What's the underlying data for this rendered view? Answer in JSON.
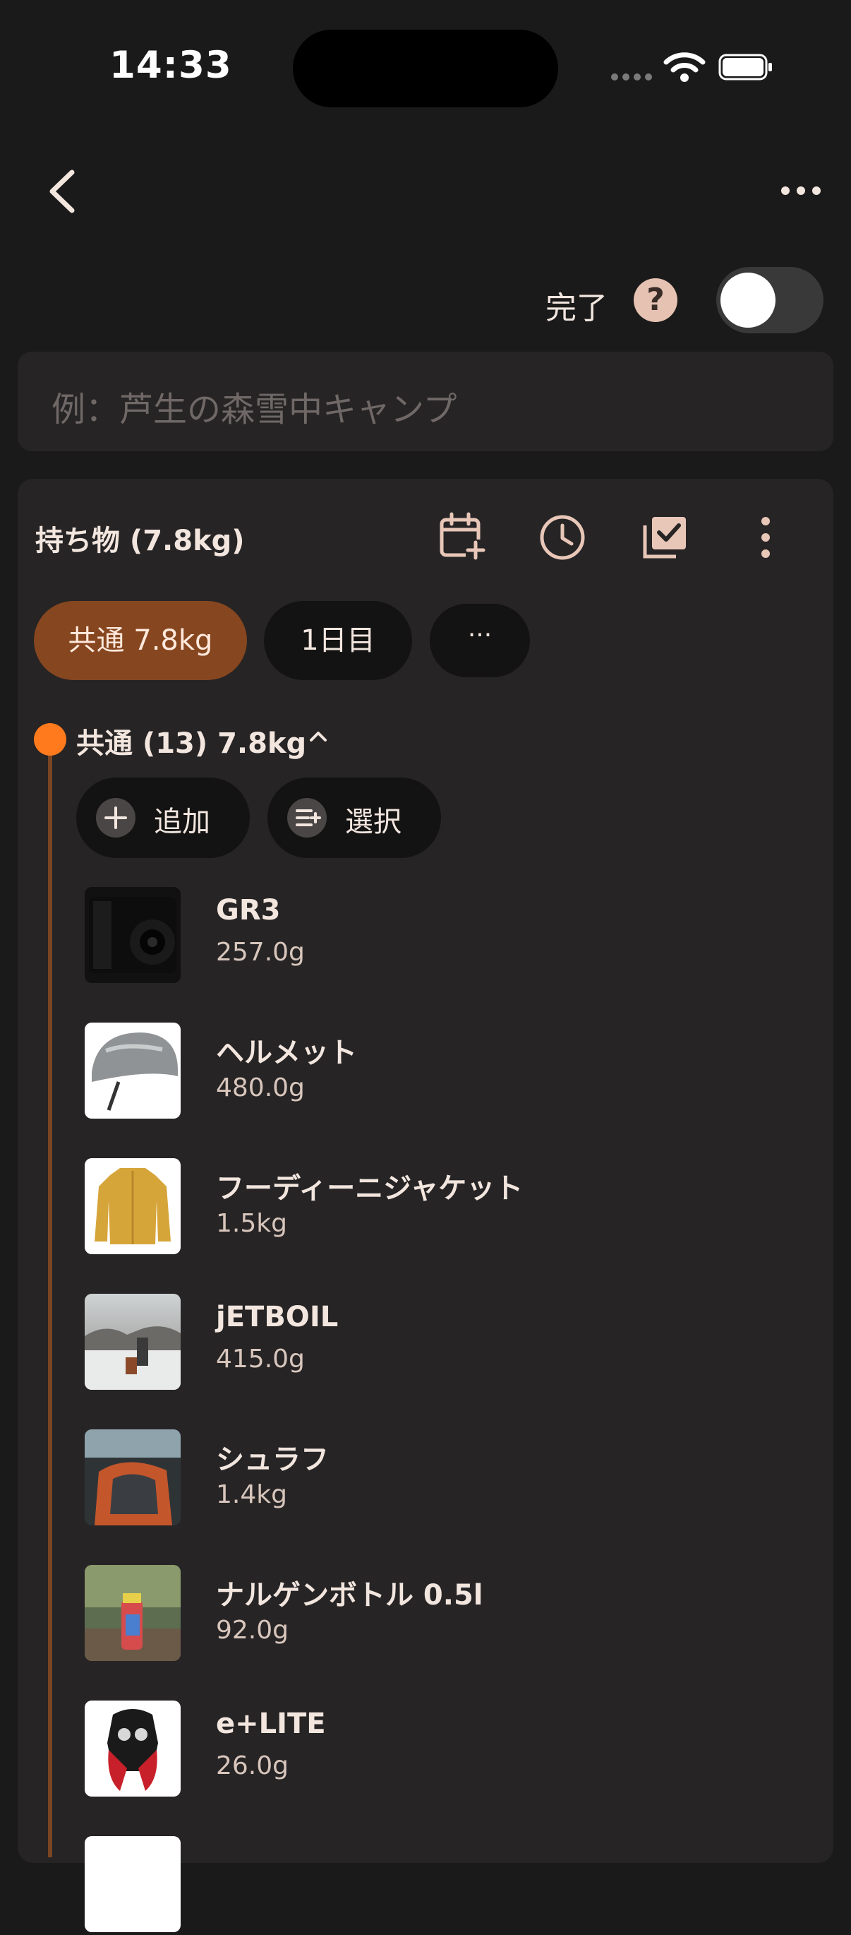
{
  "status": {
    "time": "14:33"
  },
  "header": {
    "done_label": "完了",
    "help_label": "?"
  },
  "title_input": {
    "placeholder": "例：芦生の森雪中キャンプ"
  },
  "packing": {
    "title": "持ち物 (7.8kg)",
    "tabs": [
      {
        "label": "共通 7.8kg",
        "active": true
      },
      {
        "label": "1日目",
        "active": false
      },
      {
        "label": "···",
        "active": false
      }
    ],
    "group": {
      "label": "共通 (13) 7.8kg",
      "accent": "#ff7a1c"
    },
    "actions": {
      "add_label": "追加",
      "select_label": "選択"
    },
    "items": [
      {
        "name": "GR3",
        "weight": "257.0g"
      },
      {
        "name": "ヘルメット",
        "weight": "480.0g"
      },
      {
        "name": "フーディーニジャケット",
        "weight": "1.5kg"
      },
      {
        "name": "jETBOIL",
        "weight": "415.0g"
      },
      {
        "name": "シュラフ",
        "weight": "1.4kg"
      },
      {
        "name": "ナルゲンボトル 0.5l",
        "weight": "92.0g"
      },
      {
        "name": "e+LITE",
        "weight": "26.0g"
      }
    ]
  },
  "colors": {
    "background": "#1b1a1a",
    "card": "#262425",
    "active_tab": "#86461f",
    "accent": "#ff7a1c"
  },
  "icons": [
    "back-icon",
    "more-horizontal-icon",
    "help-icon",
    "calendar-add-icon",
    "clock-icon",
    "checklist-icon",
    "more-vertical-icon",
    "plus-icon",
    "select-list-icon",
    "chevron-up-icon"
  ]
}
